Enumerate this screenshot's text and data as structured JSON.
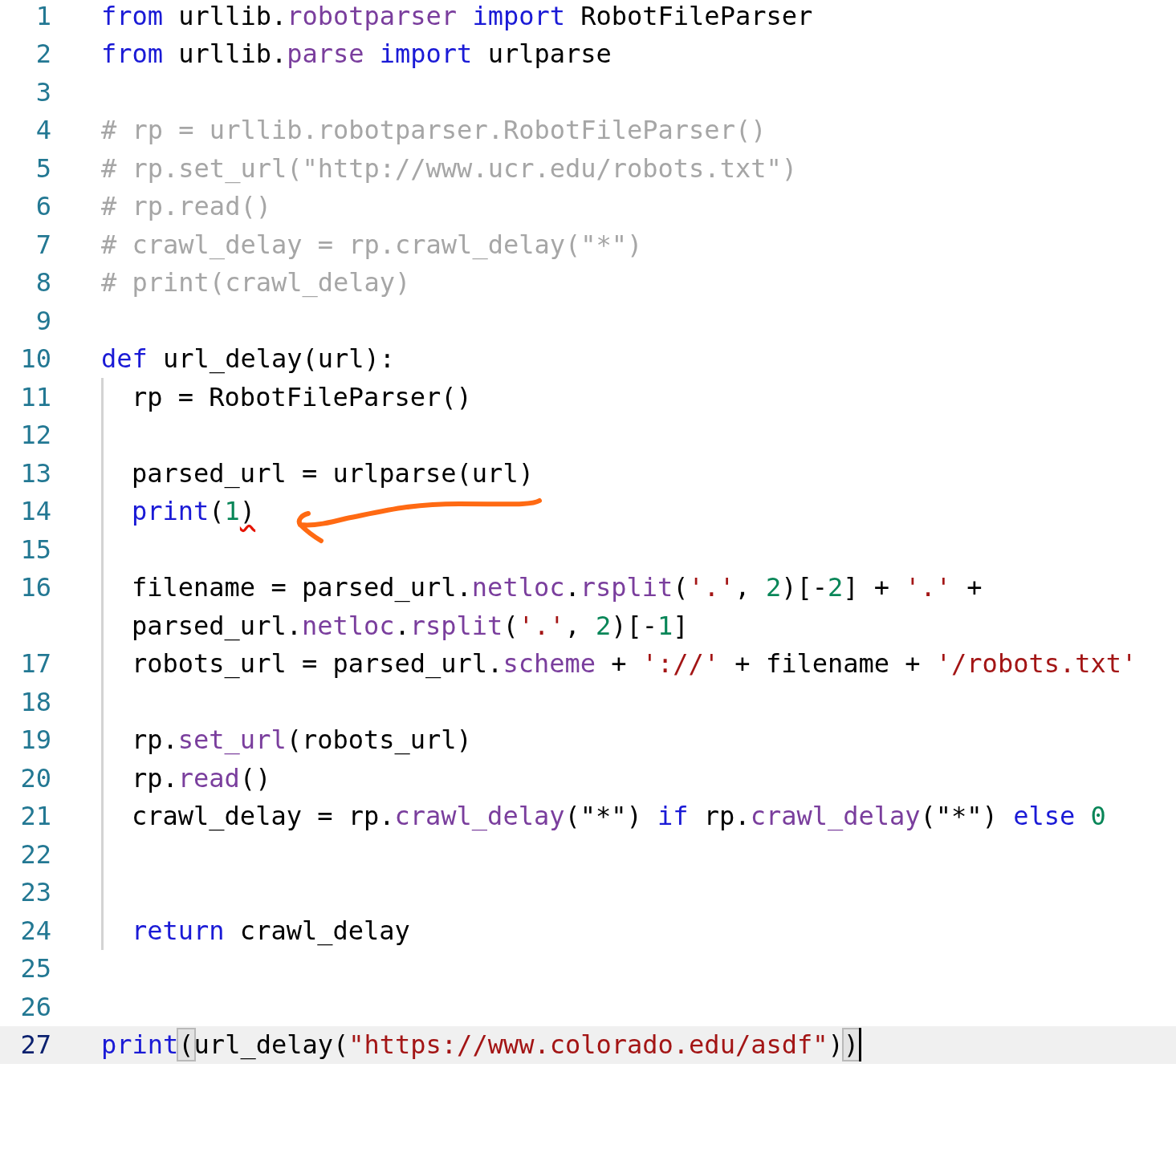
{
  "editor": {
    "lines": [
      {
        "number": "1",
        "indented": false,
        "current": false,
        "tokens": [
          {
            "t": "from",
            "kind": "keyword"
          },
          {
            "t": " urllib.",
            "kind": "plain"
          },
          {
            "t": "robotparser",
            "kind": "attr"
          },
          {
            "t": " import",
            "kind": "keyword"
          },
          {
            "t": " RobotFileParser",
            "kind": "plain"
          }
        ]
      },
      {
        "number": "2",
        "indented": false,
        "current": false,
        "tokens": [
          {
            "t": "from",
            "kind": "keyword"
          },
          {
            "t": " urllib.",
            "kind": "plain"
          },
          {
            "t": "parse",
            "kind": "attr"
          },
          {
            "t": " import",
            "kind": "keyword"
          },
          {
            "t": " urlparse",
            "kind": "plain"
          }
        ]
      },
      {
        "number": "3",
        "indented": false,
        "current": false
      },
      {
        "number": "4",
        "indented": false,
        "current": false,
        "tokens": [
          {
            "t": "# rp = urllib.robotparser.RobotFileParser()",
            "kind": "comment"
          }
        ]
      },
      {
        "number": "5",
        "indented": false,
        "current": false,
        "tokens": [
          {
            "t": "# rp.set_url(\"http://www.ucr.edu/robots.txt\")",
            "kind": "comment"
          }
        ]
      },
      {
        "number": "6",
        "indented": false,
        "current": false,
        "tokens": [
          {
            "t": "# rp.read()",
            "kind": "comment"
          }
        ]
      },
      {
        "number": "7",
        "indented": false,
        "current": false,
        "tokens": [
          {
            "t": "# crawl_delay = rp.crawl_delay(\"*\")",
            "kind": "comment"
          }
        ]
      },
      {
        "number": "8",
        "indented": false,
        "current": false,
        "tokens": [
          {
            "t": "# print(crawl_delay)",
            "kind": "comment"
          }
        ]
      },
      {
        "number": "9",
        "indented": false,
        "current": false
      },
      {
        "number": "10",
        "indented": false,
        "current": false,
        "tokens": [
          {
            "t": "def",
            "kind": "keyword"
          },
          {
            "t": " url_delay(url):",
            "kind": "plain"
          }
        ]
      },
      {
        "number": "11",
        "indented": true,
        "current": false,
        "tokens": [
          {
            "t": "rp = RobotFileParser()",
            "kind": "plain"
          }
        ]
      },
      {
        "number": "12",
        "indented": true,
        "current": false
      },
      {
        "number": "13",
        "indented": true,
        "current": false,
        "tokens": [
          {
            "t": "parsed_url = urlparse(url)",
            "kind": "plain"
          }
        ]
      },
      {
        "number": "14",
        "indented": true,
        "current": false,
        "tokens": [
          {
            "t": "print",
            "kind": "keyword"
          },
          {
            "t": "(",
            "kind": "plain"
          },
          {
            "t": "1",
            "kind": "number"
          },
          {
            "t": ")",
            "kind": "plain",
            "error": true
          }
        ]
      },
      {
        "number": "15",
        "indented": true,
        "current": false
      },
      {
        "number": "16",
        "indented": true,
        "current": false,
        "tokens": [
          {
            "t": "filename = parsed_url.",
            "kind": "plain"
          },
          {
            "t": "netloc",
            "kind": "attr"
          },
          {
            "t": ".",
            "kind": "plain"
          },
          {
            "t": "rsplit",
            "kind": "attr"
          },
          {
            "t": "(",
            "kind": "plain"
          },
          {
            "t": "'.'",
            "kind": "string"
          },
          {
            "t": ", ",
            "kind": "plain"
          },
          {
            "t": "2",
            "kind": "number"
          },
          {
            "t": ")[-",
            "kind": "plain"
          },
          {
            "t": "2",
            "kind": "number"
          },
          {
            "t": "] + ",
            "kind": "plain"
          },
          {
            "t": "'.'",
            "kind": "string"
          },
          {
            "t": " +",
            "kind": "plain"
          }
        ],
        "wrapped": [
          {
            "t": "parsed_url.",
            "kind": "plain"
          },
          {
            "t": "netloc",
            "kind": "attr"
          },
          {
            "t": ".",
            "kind": "plain"
          },
          {
            "t": "rsplit",
            "kind": "attr"
          },
          {
            "t": "(",
            "kind": "plain"
          },
          {
            "t": "'.'",
            "kind": "string"
          },
          {
            "t": ", ",
            "kind": "plain"
          },
          {
            "t": "2",
            "kind": "number"
          },
          {
            "t": ")[-",
            "kind": "plain"
          },
          {
            "t": "1",
            "kind": "number"
          },
          {
            "t": "]",
            "kind": "plain"
          }
        ]
      },
      {
        "number": "17",
        "indented": true,
        "current": false,
        "tokens": [
          {
            "t": "robots_url = parsed_url.",
            "kind": "plain"
          },
          {
            "t": "scheme",
            "kind": "attr"
          },
          {
            "t": " + ",
            "kind": "plain"
          },
          {
            "t": "'://'",
            "kind": "string"
          },
          {
            "t": " + filename + ",
            "kind": "plain"
          },
          {
            "t": "'/robots.txt'",
            "kind": "string"
          }
        ]
      },
      {
        "number": "18",
        "indented": true,
        "current": false
      },
      {
        "number": "19",
        "indented": true,
        "current": false,
        "tokens": [
          {
            "t": "rp.",
            "kind": "plain"
          },
          {
            "t": "set_url",
            "kind": "attr"
          },
          {
            "t": "(robots_url)",
            "kind": "plain"
          }
        ]
      },
      {
        "number": "20",
        "indented": true,
        "current": false,
        "tokens": [
          {
            "t": "rp.",
            "kind": "plain"
          },
          {
            "t": "read",
            "kind": "attr"
          },
          {
            "t": "()",
            "kind": "plain"
          }
        ]
      },
      {
        "number": "21",
        "indented": true,
        "current": false,
        "tokens": [
          {
            "t": "crawl_delay = rp.",
            "kind": "plain"
          },
          {
            "t": "crawl_delay",
            "kind": "attr"
          },
          {
            "t": "(\"*\") ",
            "kind": "plain"
          },
          {
            "t": "if",
            "kind": "keyword"
          },
          {
            "t": " rp.",
            "kind": "plain"
          },
          {
            "t": "crawl_delay",
            "kind": "attr"
          },
          {
            "t": "(\"*\") ",
            "kind": "plain"
          },
          {
            "t": "else",
            "kind": "keyword"
          },
          {
            "t": " 0",
            "kind": "number"
          }
        ]
      },
      {
        "number": "22",
        "indented": true,
        "current": false
      },
      {
        "number": "23",
        "indented": true,
        "current": false
      },
      {
        "number": "24",
        "indented": true,
        "current": false,
        "tokens": [
          {
            "t": "return",
            "kind": "keyword"
          },
          {
            "t": " crawl_delay",
            "kind": "plain"
          }
        ]
      },
      {
        "number": "25",
        "indented": false,
        "current": false
      },
      {
        "number": "26",
        "indented": false,
        "current": false
      },
      {
        "number": "27",
        "indented": false,
        "current": true,
        "cursor": true,
        "tokens": [
          {
            "t": "print",
            "kind": "keyword"
          },
          {
            "t": "(",
            "kind": "plain",
            "bracket_match": true
          },
          {
            "t": "url_delay(",
            "kind": "plain"
          },
          {
            "t": "\"https://www.colorado.edu/asdf\"",
            "kind": "string"
          },
          {
            "t": ")",
            "kind": "plain"
          },
          {
            "t": ")",
            "kind": "plain",
            "bracket_match": true
          }
        ]
      }
    ]
  }
}
